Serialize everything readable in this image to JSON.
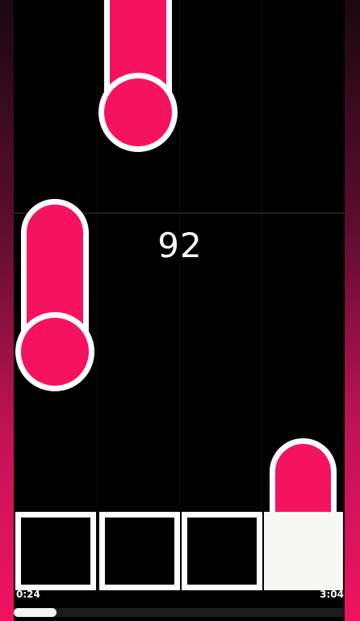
{
  "game": {
    "score": "92",
    "lanes": 4,
    "active_key": 4
  },
  "playback": {
    "elapsed": "0:24",
    "total": "3:04",
    "progress": 0.13
  },
  "colors": {
    "tile": "#f5135f",
    "outline": "#ffffff",
    "background": "#000000",
    "side_gradient_end": "#f0135f"
  }
}
